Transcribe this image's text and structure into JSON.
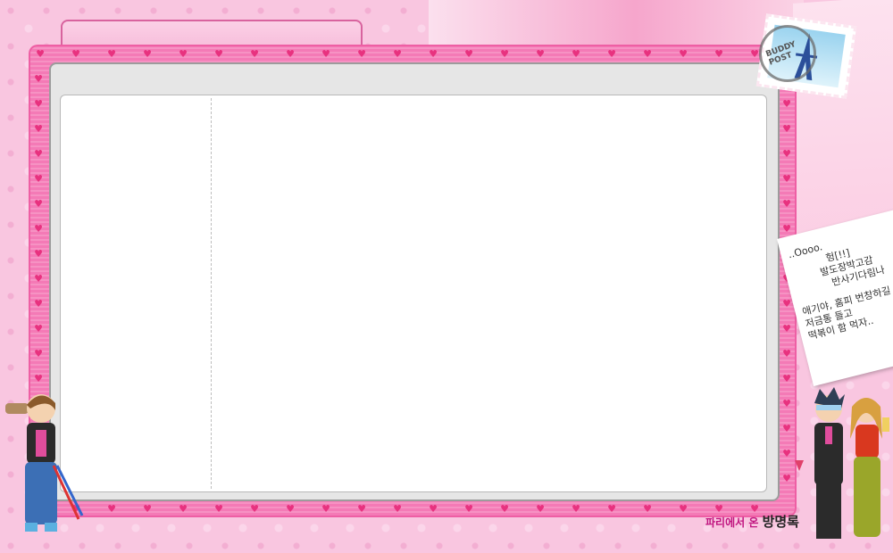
{
  "header": {
    "title": ""
  },
  "note": {
    "lines": [
      "..Oooo.",
      "헝[!!]",
      "발도장박고감",
      "반사기다림나",
      "애기야, 홈피 번창하길",
      "저금통 들고",
      "떡볶이 함 먹자.."
    ]
  },
  "stamp": {
    "postmark": "BUDDY POST"
  },
  "footer": {
    "prefix": "파리에서 온",
    "title": "방명록"
  },
  "colors": {
    "frame": "#f47ab6",
    "background": "#f9c6e0",
    "accent": "#c0147f"
  }
}
